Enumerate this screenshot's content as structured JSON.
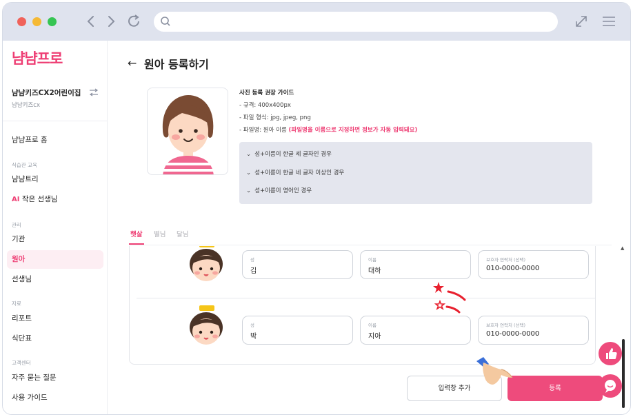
{
  "brand": {
    "logo_text": "냠냠프로",
    "accent_color": "#ee3e74"
  },
  "browser": {
    "url": ""
  },
  "sidebar": {
    "org_name": "냠냠키즈CX2어린이집",
    "org_sub": "냠냠키즈cx",
    "items": [
      {
        "label": "냠냠프로 홈"
      },
      {
        "section": "식습관 교육"
      },
      {
        "label": "냠냠트리"
      },
      {
        "ai": "AI",
        "label": "작은 선생님"
      },
      {
        "section": "관리"
      },
      {
        "label": "기관"
      },
      {
        "label": "원아",
        "active": true
      },
      {
        "label": "선생님"
      },
      {
        "section": "자료"
      },
      {
        "label": "리포트"
      },
      {
        "label": "식단표"
      },
      {
        "section": "고객센터"
      },
      {
        "label": "자주 묻는 질문"
      },
      {
        "label": "사용 가이드"
      }
    ]
  },
  "page": {
    "back_icon": "arrow-left-icon",
    "title": "원아 등록하기"
  },
  "guide": {
    "title": "사진 등록 권장 가이드",
    "lines": [
      {
        "text": "- 규격: 400x400px"
      },
      {
        "text": "- 파일 형식: jpg, jpeg, png"
      },
      {
        "text": "- 파일명: 원아 이름 ",
        "highlight": "(파일명을 이름으로 지정하면 정보가 자동 입력돼요)"
      }
    ],
    "accordion": [
      "성+이름이 한글 세 글자인 경우",
      "성+이름이 한글 네 글자 이상인 경우",
      "성+이름이 영어인 경우"
    ]
  },
  "tabs": [
    "햇살",
    "별님",
    "달님"
  ],
  "children": [
    {
      "last_name_label": "성",
      "last_name": "김",
      "first_name_label": "이름",
      "first_name": "대하",
      "phone_label": "보호자 연락처 (선택)",
      "phone": "010-0000-0000"
    },
    {
      "last_name_label": "성",
      "last_name": "박",
      "first_name_label": "이름",
      "first_name": "지아",
      "phone_label": "보호자 연락처 (선택)",
      "phone": "010-0000-0000"
    }
  ],
  "actions": {
    "add_label": "입력창 추가",
    "register_label": "등록"
  },
  "floating": {
    "like_icon": "thumbs-up-icon",
    "chat_icon": "chat-icon"
  }
}
